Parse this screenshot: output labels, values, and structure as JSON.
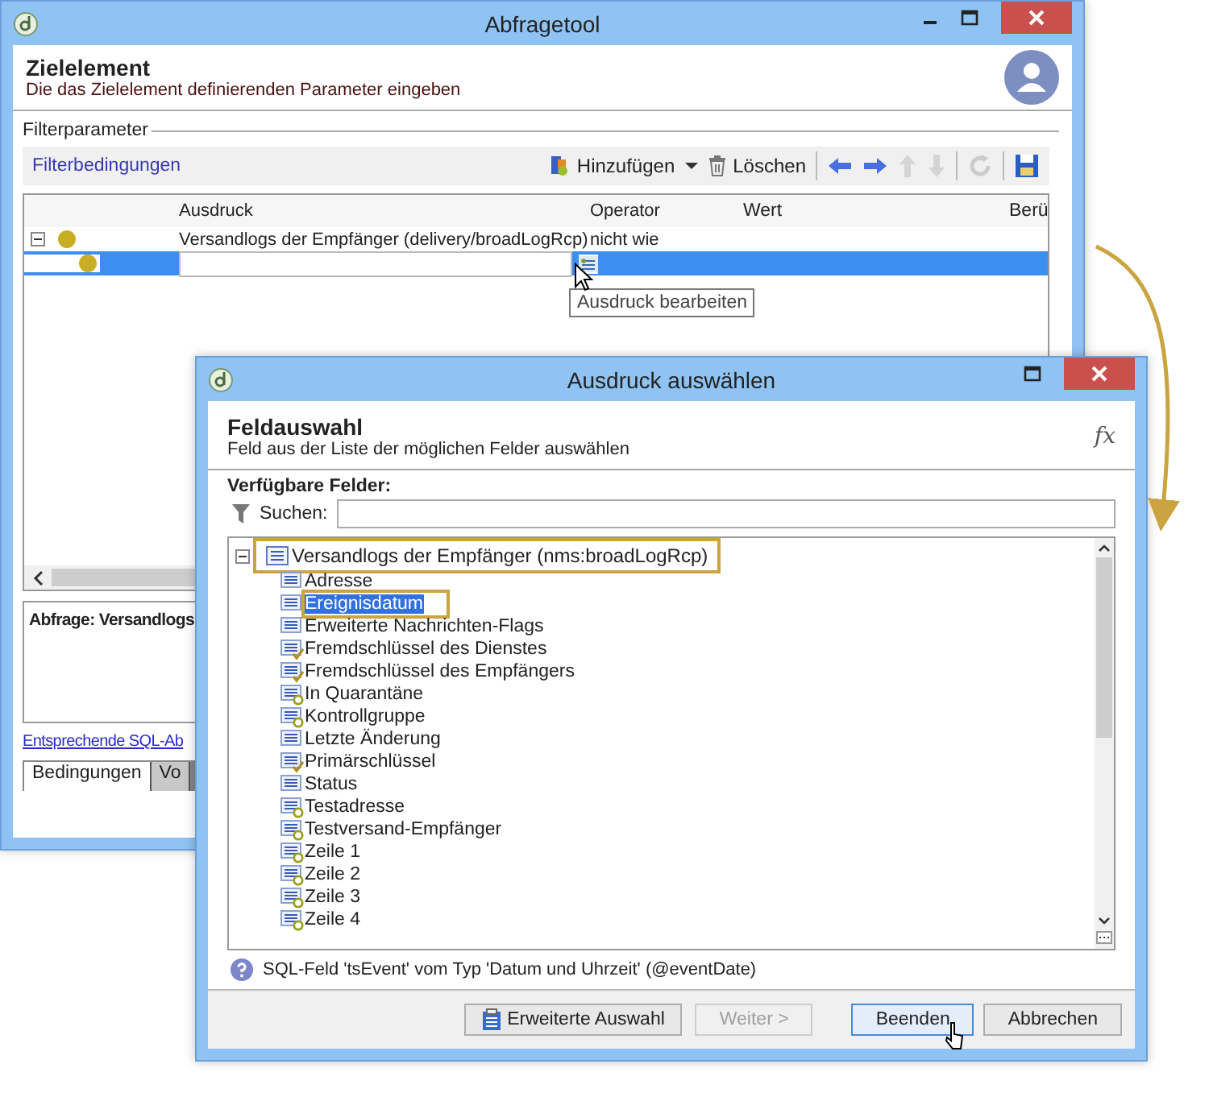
{
  "back_window": {
    "title": "Abfragetool",
    "header": {
      "title": "Zielelement",
      "subtitle": "Die das Zielelement definierenden Parameter eingeben"
    },
    "section_label": "Filterparameter",
    "toolbar": {
      "label": "Filterbedingungen",
      "add": "Hinzufügen",
      "delete": "Löschen"
    },
    "table": {
      "columns": [
        "Ausdruck",
        "Operator",
        "Wert",
        "Berü"
      ],
      "rows": [
        {
          "expression": "Versandlogs der Empfänger (delivery/broadLogRcp)",
          "operator": "nicht wie",
          "selected": false,
          "editing": false
        },
        {
          "expression": "",
          "operator": "",
          "selected": true,
          "editing": true
        }
      ]
    },
    "tooltip": "Ausdruck bearbeiten",
    "query_label": "Abfrage: Versandlogs",
    "sql_link": "Entsprechende SQL-Ab",
    "tabs": [
      {
        "label": "Bedingungen",
        "selected": true
      },
      {
        "label": "Vo",
        "selected": false
      }
    ]
  },
  "dialog": {
    "title": "Ausdruck auswählen",
    "header": {
      "title": "Feldauswahl",
      "subtitle": "Feld aus der Liste der möglichen Felder auswählen",
      "fx": "fx"
    },
    "fields_label": "Verfügbare Felder:",
    "search_label": "Suchen:",
    "tree": {
      "label": "Versandlogs der Empfänger (nms:broadLogRcp)",
      "expanded": true,
      "highlighted": true,
      "children": [
        {
          "label": "Adresse",
          "kind": "field",
          "selected": false,
          "highlighted": false
        },
        {
          "label": "Ereignisdatum",
          "kind": "field",
          "selected": true,
          "highlighted": true
        },
        {
          "label": "Erweiterte Nachrichten-Flags",
          "kind": "field",
          "selected": false,
          "highlighted": false
        },
        {
          "label": "Fremdschlüssel des Dienstes",
          "kind": "link",
          "selected": false,
          "highlighted": false
        },
        {
          "label": "Fremdschlüssel des Empfängers",
          "kind": "link",
          "selected": false,
          "highlighted": false
        },
        {
          "label": "In Quarantäne",
          "kind": "enum",
          "selected": false,
          "highlighted": false
        },
        {
          "label": "Kontrollgruppe",
          "kind": "enum",
          "selected": false,
          "highlighted": false
        },
        {
          "label": "Letzte Änderung",
          "kind": "field",
          "selected": false,
          "highlighted": false
        },
        {
          "label": "Primärschlüssel",
          "kind": "link",
          "selected": false,
          "highlighted": false
        },
        {
          "label": "Status",
          "kind": "field",
          "selected": false,
          "highlighted": false
        },
        {
          "label": "Testadresse",
          "kind": "enum",
          "selected": false,
          "highlighted": false
        },
        {
          "label": "Testversand-Empfänger",
          "kind": "enum",
          "selected": false,
          "highlighted": false
        },
        {
          "label": "Zeile 1",
          "kind": "enum",
          "selected": false,
          "highlighted": false
        },
        {
          "label": "Zeile 2",
          "kind": "enum",
          "selected": false,
          "highlighted": false
        },
        {
          "label": "Zeile 3",
          "kind": "enum",
          "selected": false,
          "highlighted": false
        },
        {
          "label": "Zeile 4",
          "kind": "enum",
          "selected": false,
          "highlighted": false
        }
      ]
    },
    "status": "SQL-Feld 'tsEvent' vom Typ 'Datum und Uhrzeit' (@eventDate)",
    "buttons": [
      {
        "label": "Erweiterte Auswahl",
        "kind": "icon",
        "disabled": false,
        "default": false
      },
      {
        "label": "Weiter >",
        "kind": "plain",
        "disabled": true,
        "default": false
      },
      {
        "label": "Beenden",
        "kind": "plain",
        "disabled": false,
        "default": true
      },
      {
        "label": "Abbrechen",
        "kind": "plain",
        "disabled": false,
        "default": false
      }
    ]
  }
}
